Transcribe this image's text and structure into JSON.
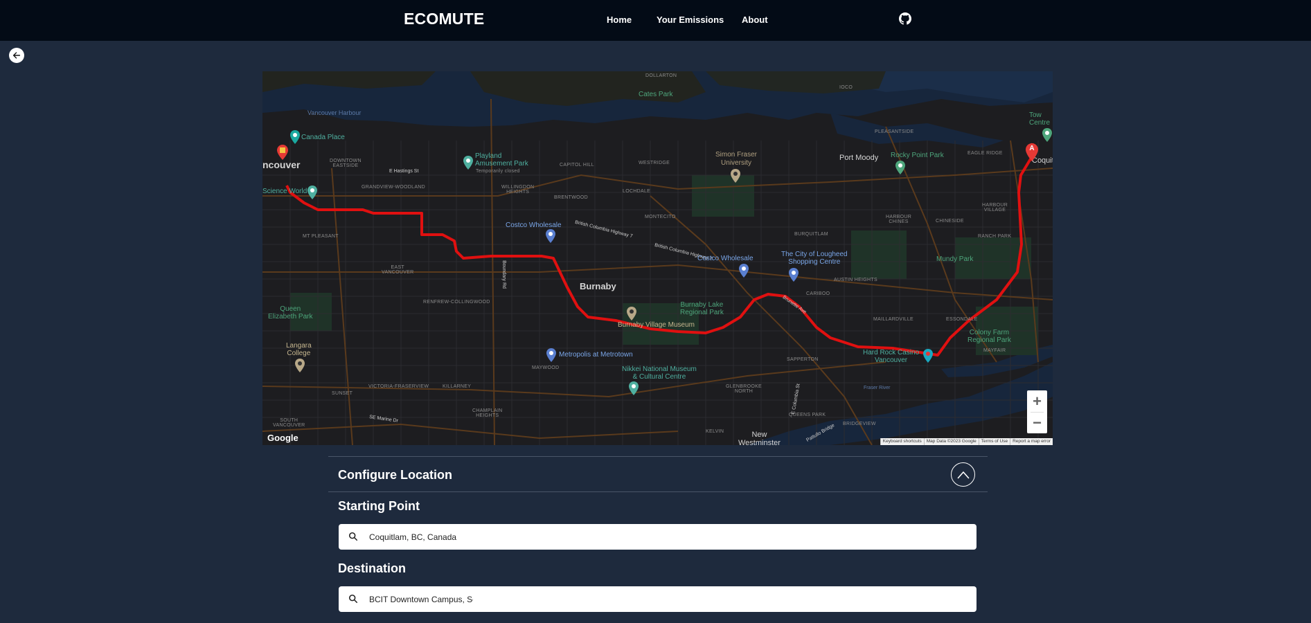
{
  "nav": {
    "brand": "ECOMUTE",
    "links": [
      "Home",
      "Your Emissions",
      "About"
    ],
    "github_icon": "github-icon"
  },
  "back_icon": "arrow-left-icon",
  "map": {
    "labels": {
      "dollarton": "DOLLARTON",
      "cates_park": "Cates Park",
      "ioco": "IOCO",
      "vancouver_harbour": "Vancouver Harbour",
      "canada_place": "Canada Place",
      "vancouver": "ncouver",
      "downtown_eastside": "DOWNTOWN\nEASTSIDE",
      "e_hastings": "E Hastings St",
      "grandview": "GRANDVIEW-WOODLAND",
      "science_world": "Science World",
      "playland": "Playland\nAmusement Park",
      "temporarily_closed": "Temporarily closed",
      "capitol_hill": "CAPITOL HILL",
      "willingdon": "WILLINGDON\nHEIGHTS",
      "westridge": "WESTRIDGE",
      "brentwood": "BRENTWOOD",
      "lochdale": "LOCHDALE",
      "sfu": "Simon Fraser\nUniversity",
      "port_moody": "Port Moody",
      "rocky_point": "Rocky Point Park",
      "pleasantside": "PLEASANTSIDE",
      "eagle_ridge": "EAGLE RIDGE",
      "coquitlam": "Coquitlam",
      "town_centre": "Tow\nCentre",
      "costco1": "Costco Wholesale",
      "bc_highway": "British Columbia Highway 7",
      "bc_highway2": "British Columbia Highway 7",
      "montecito": "MONTECITO",
      "mt_pleasant": "MT PLEASANT",
      "east_vancouver": "EAST\nVANCOUVER",
      "boundary_rd": "Boundary Rd",
      "renfrew": "RENFREW-COLLINGWOOD",
      "burnaby": "Burnaby",
      "costco2": "Costco Wholesale",
      "lougheed": "The City of Lougheed\nShopping Centre",
      "burquitlam": "BURQUITLAM",
      "austin_heights": "AUSTIN HEIGHTS",
      "harbour_chines": "HARBOUR\nCHINES",
      "chineside": "CHINESIDE",
      "harbour_village": "HARBOUR\nVILLAGE",
      "ranch_park": "RANCH PARK",
      "mundy_park": "Mundy Park",
      "queen_elizabeth": "Queen\nElizabeth Park",
      "burnaby_lake": "Burnaby Lake\nRegional Park",
      "burnaby_village": "Burnaby Village Museum",
      "cariboo": "CARIBOO",
      "maillardville": "MAILLARDVILLE",
      "essondale": "ESSONDALE",
      "colony_farm": "Colony Farm\nRegional Park",
      "langara": "Langara\nCollege",
      "metropolis": "Metropolis at Metrotown",
      "maywood": "MAYWOOD",
      "sapperton": "SAPPERTON",
      "hard_rock": "Hard Rock Casino\nVancouver",
      "mayfair": "MAYFAIR",
      "fraser_river": "Fraser River",
      "nikkei": "Nikkei National Museum\n& Cultural Centre",
      "victoria_fraserview": "VICTORIA-FRASERVIEW",
      "killarney": "KILLARNEY",
      "sunset": "SUNSET",
      "champlain": "CHAMPLAIN\nHEIGHTS",
      "glenbrooke": "GLENBROOKE\nNORTH",
      "queens_park": "QUEENS PARK",
      "bridgeview": "BRIDGEVIEW",
      "south_vancouver": "SOUTH\nVANCOUVER",
      "se_marine": "SE Marine Dr",
      "kelvin": "KELVIN",
      "new_westminster": "New\nWestminster",
      "e_columbia": "E Columbia St",
      "pattullo": "Pattullo Bridge",
      "brunette": "Brunette Ave"
    },
    "marker_a": "A",
    "google": "Google",
    "attribution": [
      "Keyboard shortcuts",
      "Map Data ©2023 Google",
      "Terms of Use",
      "Report a map error"
    ],
    "zoom_in": "+",
    "zoom_out": "−"
  },
  "config": {
    "title": "Configure Location",
    "collapse_icon": "chevron-up-icon",
    "starting_label": "Starting Point",
    "starting_value": "Coquitlam, BC, Canada",
    "destination_label": "Destination",
    "destination_value": "BCIT Downtown Campus, Seymour Street, Vancouver, BC, Canada"
  },
  "colors": {
    "navbar": "#030b16",
    "page": "#1e2a3d",
    "route": "#e01010",
    "map_bg": "#1d1d20",
    "water": "#17263c"
  }
}
